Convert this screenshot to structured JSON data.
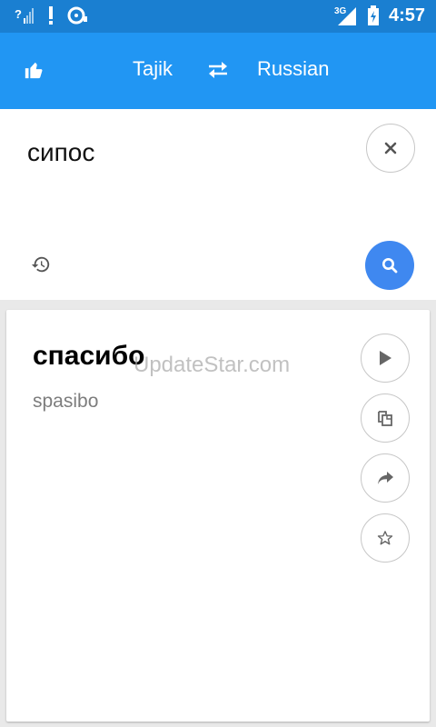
{
  "status_bar": {
    "time": "4:57",
    "network": "3G",
    "icons": [
      "signal-icon",
      "alert-icon",
      "sync-icon",
      "battery-icon"
    ]
  },
  "app_bar": {
    "source_language": "Tajik",
    "target_language": "Russian",
    "icons": [
      "thumbs-up-icon",
      "swap-icon"
    ]
  },
  "input": {
    "text": "сипос",
    "icons": [
      "clear-icon",
      "history-icon",
      "search-icon"
    ]
  },
  "result": {
    "translation": "спасибо",
    "transliteration": "spasibo",
    "watermark": "UpdateStar.com",
    "icons": [
      "play-icon",
      "copy-icon",
      "share-icon",
      "star-icon"
    ]
  },
  "colors": {
    "status_bar": "#1a7fd1",
    "app_bar": "#2196f3",
    "search_button": "#3f88f0",
    "background": "#e9e9e9"
  }
}
